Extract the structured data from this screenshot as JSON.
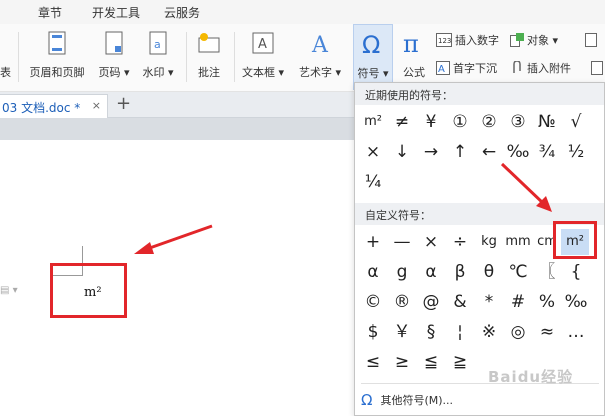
{
  "menubar": {
    "items": [
      "章节",
      "开发工具",
      "云服务"
    ]
  },
  "ribbon": {
    "left_cut_label": "表",
    "header_footer": "页眉和页脚",
    "page_number": "页码",
    "watermark": "水印",
    "annotation": "批注",
    "textbox": "文本框",
    "art_text": "艺术字",
    "symbol": "符号",
    "formula": "公式",
    "insert_number": "插入数字",
    "object": "对象",
    "drop_cap": "首字下沉",
    "insert_attachment": "插入附件"
  },
  "tab": {
    "label": "03 文档.doc *",
    "close": "×",
    "new": "+"
  },
  "document": {
    "content": "m²"
  },
  "dropdown": {
    "recent_title": "近期使用的符号：",
    "recent_row1": [
      "m²",
      "≠",
      "¥",
      "①",
      "②",
      "③",
      "№",
      "√"
    ],
    "recent_row2": [
      "×",
      "↓",
      "→",
      "↑",
      "←",
      "‰",
      "¾",
      "½"
    ],
    "recent_row3": [
      "¼"
    ],
    "custom_title": "自定义符号：",
    "custom_row1": [
      "+",
      "—",
      "×",
      "÷",
      "kg",
      "mm",
      "cm",
      "m²"
    ],
    "custom_row2": [
      "α",
      "g",
      "α",
      "β",
      "θ",
      "℃",
      "〖",
      "{"
    ],
    "custom_row3": [
      "©",
      "®",
      "@",
      "&",
      "*",
      "#",
      "%",
      "‰"
    ],
    "custom_row4": [
      "$",
      "￥",
      "§",
      "¦",
      "※",
      "◎",
      "≈",
      "…"
    ],
    "custom_row5": [
      "≤",
      "≥",
      "≦",
      "≧"
    ],
    "more": "其他符号(M)..."
  },
  "watermark_text": "Baidu经验",
  "colors": {
    "annotation_red": "#e2262a",
    "accent_blue": "#2b6fd0"
  }
}
